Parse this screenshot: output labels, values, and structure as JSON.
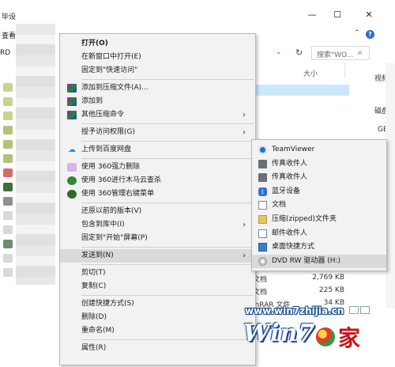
{
  "explorer": {
    "title_fragment": "毕设",
    "window_controls": {
      "minimize": "—",
      "maximize": "☐",
      "close": "✕"
    },
    "ribbon_tab": "查看",
    "address_fragment": "RD",
    "search_placeholder": "搜索\"WO...",
    "column_size": "大小",
    "right_fragments": [
      "视频",
      "磁盘",
      "GB"
    ],
    "files": [
      {
        "name": "文档",
        "size": "2,769 KB"
      },
      {
        "name": "文档",
        "size": "225 KB"
      },
      {
        "name": "inRAR 文件",
        "size": "34 KB"
      }
    ]
  },
  "context_menu": {
    "items": [
      {
        "label": "打开(O)",
        "bold": true,
        "icon": "none",
        "arrow": false
      },
      {
        "label": "在新窗口中打开(E)",
        "icon": "none",
        "arrow": false
      },
      {
        "label": "固定到\"快速访问\"",
        "icon": "none",
        "arrow": false
      },
      {
        "sep": true
      },
      {
        "label": "添加到压缩文件(A)...",
        "icon": "winrar-icon",
        "arrow": false
      },
      {
        "label": "添加到",
        "icon": "winrar-icon",
        "arrow": false
      },
      {
        "label": "其他压缩命令",
        "icon": "winrar-icon",
        "arrow": true
      },
      {
        "sep": true
      },
      {
        "label": "授予访问权限(G)",
        "icon": "none",
        "arrow": true
      },
      {
        "sep": true
      },
      {
        "label": "上传到百度网盘",
        "icon": "baidu-cloud-icon",
        "arrow": false
      },
      {
        "sep": true
      },
      {
        "label": "使用 360强力删除",
        "icon": "360-delete-icon",
        "arrow": false
      },
      {
        "label": "使用 360进行木马云查杀",
        "icon": "360-scan-icon",
        "arrow": false
      },
      {
        "label": "使用 360管理右键菜单",
        "icon": "360-manage-icon",
        "arrow": false
      },
      {
        "sep": true
      },
      {
        "label": "还原以前的版本(V)",
        "icon": "none",
        "arrow": false
      },
      {
        "label": "包含到库中(I)",
        "icon": "none",
        "arrow": true
      },
      {
        "label": "固定到\"开始\"屏幕(P)",
        "icon": "none",
        "arrow": false
      },
      {
        "sep": true
      },
      {
        "label": "发送到(N)",
        "icon": "none",
        "arrow": true,
        "highlighted": true
      },
      {
        "sep": true
      },
      {
        "label": "剪切(T)",
        "icon": "none",
        "arrow": false
      },
      {
        "label": "复制(C)",
        "icon": "none",
        "arrow": false
      },
      {
        "sep": true
      },
      {
        "label": "创建快捷方式(S)",
        "icon": "none",
        "arrow": false
      },
      {
        "label": "删除(D)",
        "icon": "none",
        "arrow": false
      },
      {
        "label": "重命名(M)",
        "icon": "none",
        "arrow": false
      },
      {
        "sep": true
      },
      {
        "label": "属性(R)",
        "icon": "none",
        "arrow": false
      }
    ]
  },
  "send_to_submenu": {
    "items": [
      {
        "label": "TeamViewer",
        "icon": "teamviewer-icon"
      },
      {
        "label": "传真收件人",
        "icon": "fax-icon"
      },
      {
        "label": "传真收件人",
        "icon": "fax-icon"
      },
      {
        "label": "蓝牙设备",
        "icon": "bluetooth-icon"
      },
      {
        "label": "文档",
        "icon": "document-icon"
      },
      {
        "label": "压缩(zipped)文件夹",
        "icon": "zip-folder-icon"
      },
      {
        "label": "邮件收件人",
        "icon": "mail-icon"
      },
      {
        "label": "桌面快捷方式",
        "icon": "desktop-icon"
      },
      {
        "label": "DVD RW 驱动器 (H:)",
        "icon": "dvd-drive-icon",
        "highlighted": true
      }
    ]
  },
  "watermark": {
    "url": "www.win7zhijia.cn",
    "logo_text": "Win7.",
    "logo_char": "家"
  }
}
